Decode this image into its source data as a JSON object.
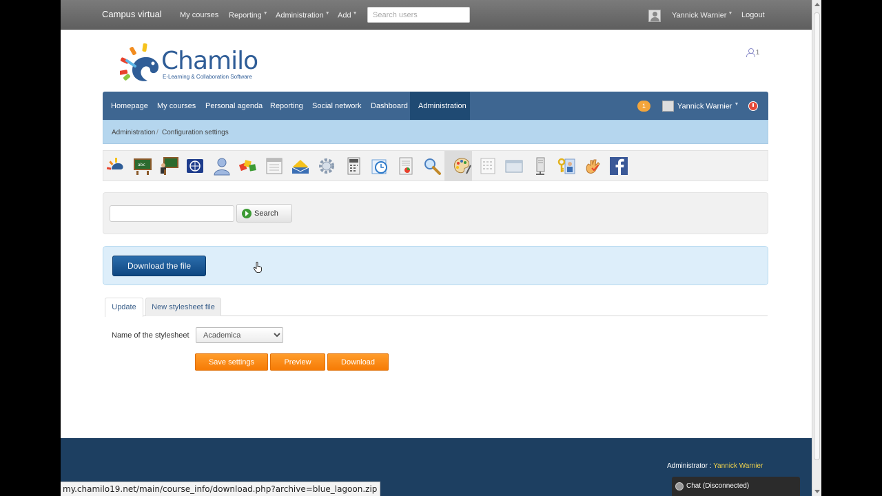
{
  "topbar": {
    "brand": "Campus virtual",
    "menu": [
      {
        "label": "My courses",
        "caret": false
      },
      {
        "label": "Reporting",
        "caret": true
      },
      {
        "label": "Administration",
        "caret": true
      },
      {
        "label": "Add",
        "caret": true
      }
    ],
    "search_placeholder": "Search users",
    "user_name": "Yannick Warnier",
    "logout": "Logout"
  },
  "header": {
    "logo_word": "Chamilo",
    "logo_tagline": "E-Learning & Collaboration Software",
    "online_count": "1"
  },
  "mainnav": {
    "items": [
      "Homepage",
      "My courses",
      "Personal agenda",
      "Reporting",
      "Social network",
      "Dashboard",
      "Administration"
    ],
    "active_index": 6,
    "notifications": "1",
    "user_name": "Yannick Warnier"
  },
  "breadcrumb": {
    "items": [
      "Administration",
      "Configuration settings"
    ],
    "separator": "/"
  },
  "toolbar": {
    "icons": [
      "chamilo-icon",
      "blackboard-icon",
      "teacher-icon",
      "world-icon",
      "user-icon",
      "cubes-icon",
      "calendar-icon",
      "mail-icon",
      "gear-icon",
      "calculator-icon",
      "clock-icon",
      "chart-icon",
      "search-icon",
      "palette-icon",
      "grid-icon",
      "window-icon",
      "server-icon",
      "security-icon",
      "hand-icon",
      "facebook-icon"
    ],
    "selected_index": 13
  },
  "search": {
    "value": "",
    "button": "Search"
  },
  "info": {
    "download_file": "Download the file"
  },
  "tabs": [
    "Update",
    "New stylesheet file"
  ],
  "form": {
    "label": "Name of the stylesheet",
    "selected": "Academica",
    "save": "Save settings",
    "preview": "Preview",
    "download": "Download"
  },
  "footer": {
    "admin_label": "Administrator :",
    "admin_name": "Yannick Warnier"
  },
  "statusbar": {
    "url": "my.chamilo19.net/main/course_info/download.php?archive=blue_lagoon.zip"
  },
  "chat": {
    "label": "Chat (Disconnected)"
  },
  "colors": {
    "nav_blue": "#3e6691",
    "nav_active": "#1f4a73",
    "breadcrumb_bg": "#b5d6ee",
    "orange": "#f67b05",
    "footer": "#1d3f61"
  }
}
